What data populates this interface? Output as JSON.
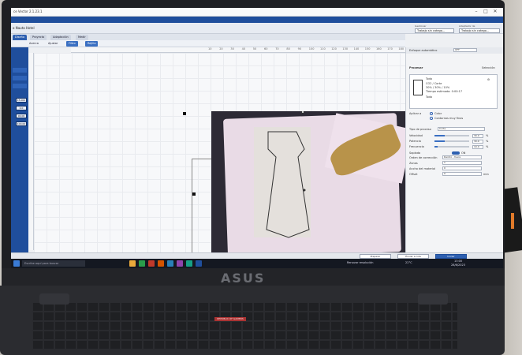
{
  "window": {
    "title": "ce Vector 2.1.23.1",
    "subtitle": "o Nauta Hotel"
  },
  "header": {
    "menu_items": [
      "Escudo",
      "Visualizar",
      "Contorneado",
      "Ocultado",
      "Corte"
    ],
    "dropdown_labels": [
      "Gestionar",
      "Adaptador de"
    ],
    "dropdowns": [
      "Trabajo sin catego...",
      "Trabajo sin catego..."
    ]
  },
  "tabs": [
    "Diseño",
    "Proyecto",
    "Adaptación",
    "Medir"
  ],
  "toolbar": {
    "buttons": [
      "Acerca",
      "Ajustar",
      "Filtro",
      "Rejilla"
    ]
  },
  "ruler": {
    "marks": [
      "10",
      "20",
      "30",
      "40",
      "50",
      "60",
      "70",
      "80",
      "90",
      "100",
      "110",
      "120",
      "130",
      "140",
      "150",
      "160",
      "170",
      "180",
      "190",
      "200",
      "210",
      "220",
      "230",
      "240",
      "250",
      "260",
      "270"
    ]
  },
  "coords": {
    "x": "X: 231.02",
    "y": "Y: 178.43",
    "unit": "(mm)",
    "focus_label": "Enfoque automático",
    "focus_value": "OFF"
  },
  "left_panel": {
    "fields": [
      "15.000",
      "0.0",
      "90.00",
      "100.00"
    ]
  },
  "right_panel": {
    "title": "Procesar",
    "settings_label": "Selección",
    "material_name": "Todo",
    "material_lines": [
      "CO2 / Corte",
      "30% / 30% / 10%",
      "Tiempo estimado: 0:00:17",
      "Todo"
    ],
    "tab_label": "Todo",
    "apply_label": "Aplicar a",
    "apply_options": [
      "Color",
      "Contornos muy finos"
    ],
    "rows": [
      {
        "label": "Tipo de proceso",
        "value": "Corte"
      },
      {
        "label": "Velocidad",
        "value": "30.0",
        "unit": "%",
        "level": 0.3
      },
      {
        "label": "Potencia",
        "value": "30.0",
        "unit": "%",
        "level": 0.3
      },
      {
        "label": "Frecuencia",
        "value": "10.0",
        "unit": "%",
        "level": 0.1
      }
    ],
    "extra_rows": [
      {
        "label": "Soplado",
        "value": "ON"
      },
      {
        "label": "Orden de corrección",
        "value": "Dentro - fuera"
      },
      {
        "label": "Zonas",
        "value": "1"
      },
      {
        "label": "Ancho del material",
        "value": "0"
      },
      {
        "label": "Offset",
        "value": "0",
        "unit": "mm"
      }
    ]
  },
  "bottom_bar": {
    "buttons": [
      "Preparar",
      "Enviar a cola",
      "Iniciar"
    ]
  },
  "taskbar": {
    "search_placeholder": "Escribe aquí para buscar",
    "status_text": "Renovar resolución",
    "temperature": "22°C",
    "tray_time": "13:00",
    "tray_date": "28/6/2023"
  },
  "laptop": {
    "brand": "ASUS",
    "sticker": "REPUBLIC OF GAMERS"
  },
  "colors": {
    "accent": "#1f4e9c",
    "bezel": "#1e1f23",
    "fabric": "#e9dbe6",
    "camera_bg": "#2d2a35"
  }
}
